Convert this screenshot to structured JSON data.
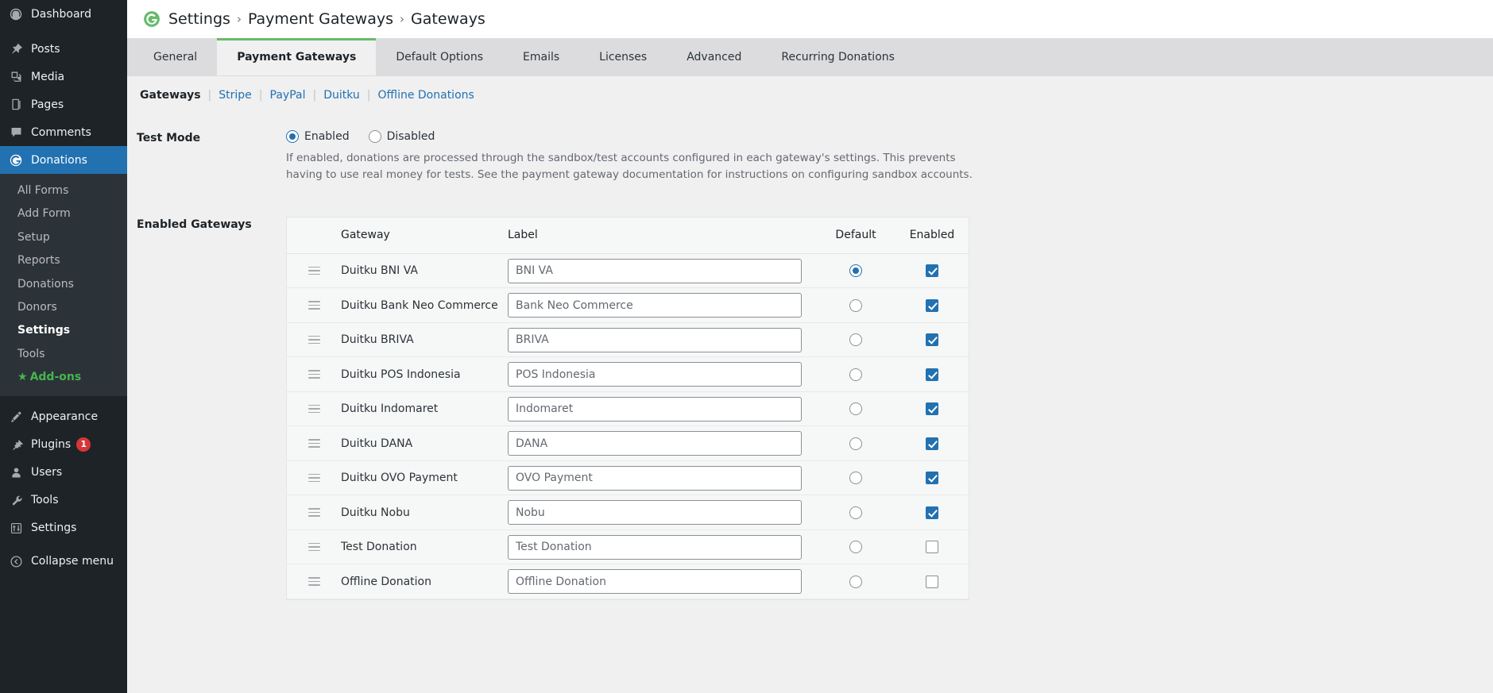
{
  "sidebar": {
    "items": [
      {
        "label": "Dashboard",
        "icon": "dashboard-icon",
        "name": "sidebar-item-dashboard"
      },
      {
        "label": "Posts",
        "icon": "pin-icon",
        "name": "sidebar-item-posts"
      },
      {
        "label": "Media",
        "icon": "media-icon",
        "name": "sidebar-item-media"
      },
      {
        "label": "Pages",
        "icon": "page-icon",
        "name": "sidebar-item-pages"
      },
      {
        "label": "Comments",
        "icon": "comment-icon",
        "name": "sidebar-item-comments"
      },
      {
        "label": "Donations",
        "icon": "givewp-icon",
        "name": "sidebar-item-donations",
        "current": true
      }
    ],
    "submenu": [
      {
        "label": "All Forms",
        "name": "submenu-item-all-forms"
      },
      {
        "label": "Add Form",
        "name": "submenu-item-add-form"
      },
      {
        "label": "Setup",
        "name": "submenu-item-setup"
      },
      {
        "label": "Reports",
        "name": "submenu-item-reports"
      },
      {
        "label": "Donations",
        "name": "submenu-item-donations"
      },
      {
        "label": "Donors",
        "name": "submenu-item-donors"
      },
      {
        "label": "Settings",
        "name": "submenu-item-settings",
        "active": true
      },
      {
        "label": "Tools",
        "name": "submenu-item-tools"
      },
      {
        "label": "Add-ons",
        "name": "submenu-item-addons",
        "addons": true,
        "star": "★"
      }
    ],
    "items_bottom": [
      {
        "label": "Appearance",
        "icon": "paintbrush-icon",
        "name": "sidebar-item-appearance"
      },
      {
        "label": "Plugins",
        "icon": "plug-icon",
        "name": "sidebar-item-plugins",
        "badge": "1"
      },
      {
        "label": "Users",
        "icon": "user-icon",
        "name": "sidebar-item-users"
      },
      {
        "label": "Tools",
        "icon": "wrench-icon",
        "name": "sidebar-item-tools"
      },
      {
        "label": "Settings",
        "icon": "sliders-icon",
        "name": "sidebar-item-settings"
      }
    ],
    "collapse": {
      "label": "Collapse menu",
      "icon": "collapse-icon",
      "name": "sidebar-item-collapse-menu"
    }
  },
  "header": {
    "logo_alt": "givewp-logo-icon",
    "breadcrumb": [
      "Settings",
      "Payment Gateways",
      "Gateways"
    ],
    "separator": "›",
    "brand_color": "#66bb6a"
  },
  "tabs": [
    {
      "label": "General",
      "active": false
    },
    {
      "label": "Payment Gateways",
      "active": true
    },
    {
      "label": "Default Options",
      "active": false
    },
    {
      "label": "Emails",
      "active": false
    },
    {
      "label": "Licenses",
      "active": false
    },
    {
      "label": "Advanced",
      "active": false
    },
    {
      "label": "Recurring Donations",
      "active": false
    }
  ],
  "subnav": [
    {
      "label": "Gateways",
      "active": true
    },
    {
      "label": "Stripe",
      "active": false
    },
    {
      "label": "PayPal",
      "active": false
    },
    {
      "label": "Duitku",
      "active": false
    },
    {
      "label": "Offline Donations",
      "active": false
    }
  ],
  "test_mode": {
    "label": "Test Mode",
    "options": [
      {
        "label": "Enabled",
        "checked": true
      },
      {
        "label": "Disabled",
        "checked": false
      }
    ],
    "description": "If enabled, donations are processed through the sandbox/test accounts configured in each gateway's settings. This prevents having to use real money for tests. See the payment gateway documentation for instructions on configuring sandbox accounts."
  },
  "enabled_gateways": {
    "label": "Enabled Gateways",
    "columns": [
      "Gateway",
      "Label",
      "Default",
      "Enabled"
    ],
    "rows": [
      {
        "gateway": "Duitku BNI VA",
        "label_value": "BNI VA",
        "default": true,
        "enabled": true
      },
      {
        "gateway": "Duitku Bank Neo Commerce",
        "label_value": "Bank Neo Commerce",
        "default": false,
        "enabled": true
      },
      {
        "gateway": "Duitku BRIVA",
        "label_value": "BRIVA",
        "default": false,
        "enabled": true
      },
      {
        "gateway": "Duitku POS Indonesia",
        "label_value": "POS Indonesia",
        "default": false,
        "enabled": true
      },
      {
        "gateway": "Duitku Indomaret",
        "label_value": "Indomaret",
        "default": false,
        "enabled": true
      },
      {
        "gateway": "Duitku DANA",
        "label_value": "DANA",
        "default": false,
        "enabled": true
      },
      {
        "gateway": "Duitku OVO Payment",
        "label_value": "OVO Payment",
        "default": false,
        "enabled": true
      },
      {
        "gateway": "Duitku Nobu",
        "label_value": "Nobu",
        "default": false,
        "enabled": true
      },
      {
        "gateway": "Test Donation",
        "label_value": "Test Donation",
        "default": false,
        "enabled": false
      },
      {
        "gateway": "Offline Donation",
        "label_value": "Offline Donation",
        "default": false,
        "enabled": false
      }
    ]
  }
}
